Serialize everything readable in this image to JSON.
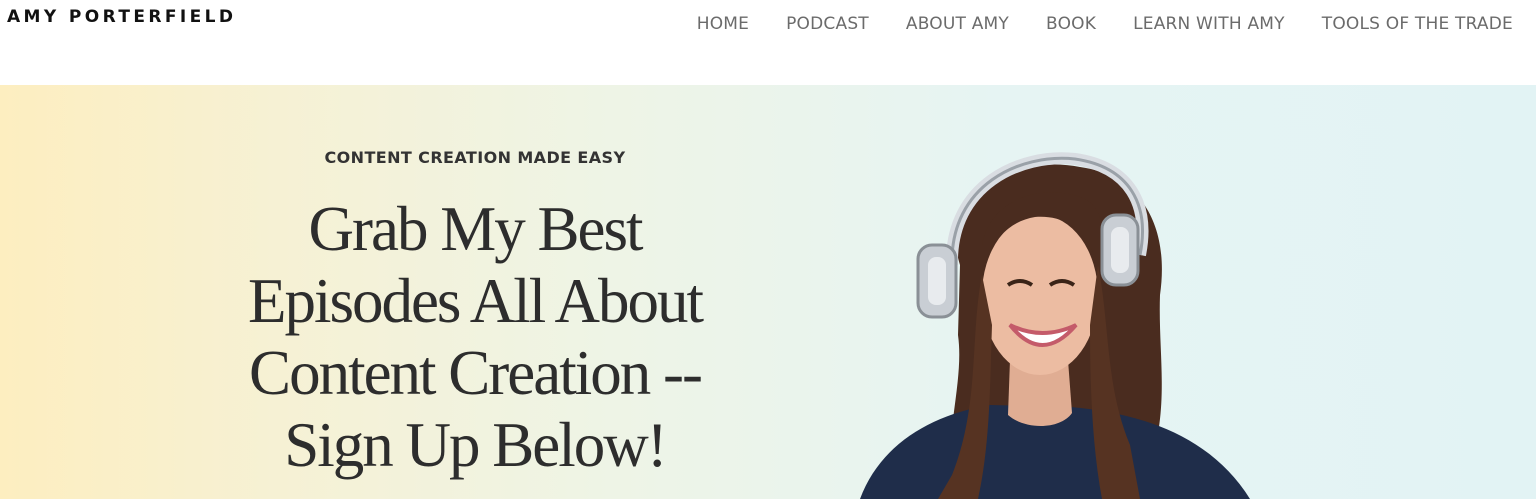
{
  "header": {
    "logo": "AMY PORTERFIELD",
    "nav": [
      {
        "label": "HOME"
      },
      {
        "label": "PODCAST"
      },
      {
        "label": "ABOUT AMY"
      },
      {
        "label": "BOOK"
      },
      {
        "label": "LEARN WITH AMY"
      },
      {
        "label": "TOOLS OF THE TRADE"
      }
    ]
  },
  "hero": {
    "eyebrow": "CONTENT CREATION MADE EASY",
    "headline_lines": [
      "Grab My Best",
      "Episodes All About",
      "Content Creation --",
      "Sign Up Below!"
    ],
    "image_alt": "Amy Porterfield smiling wearing headphones",
    "colors": {
      "gradient_left": "#fdeec0",
      "gradient_right": "#e2f3f4",
      "text": "#2d2d2d",
      "nav_text": "#6b6b6b"
    }
  }
}
